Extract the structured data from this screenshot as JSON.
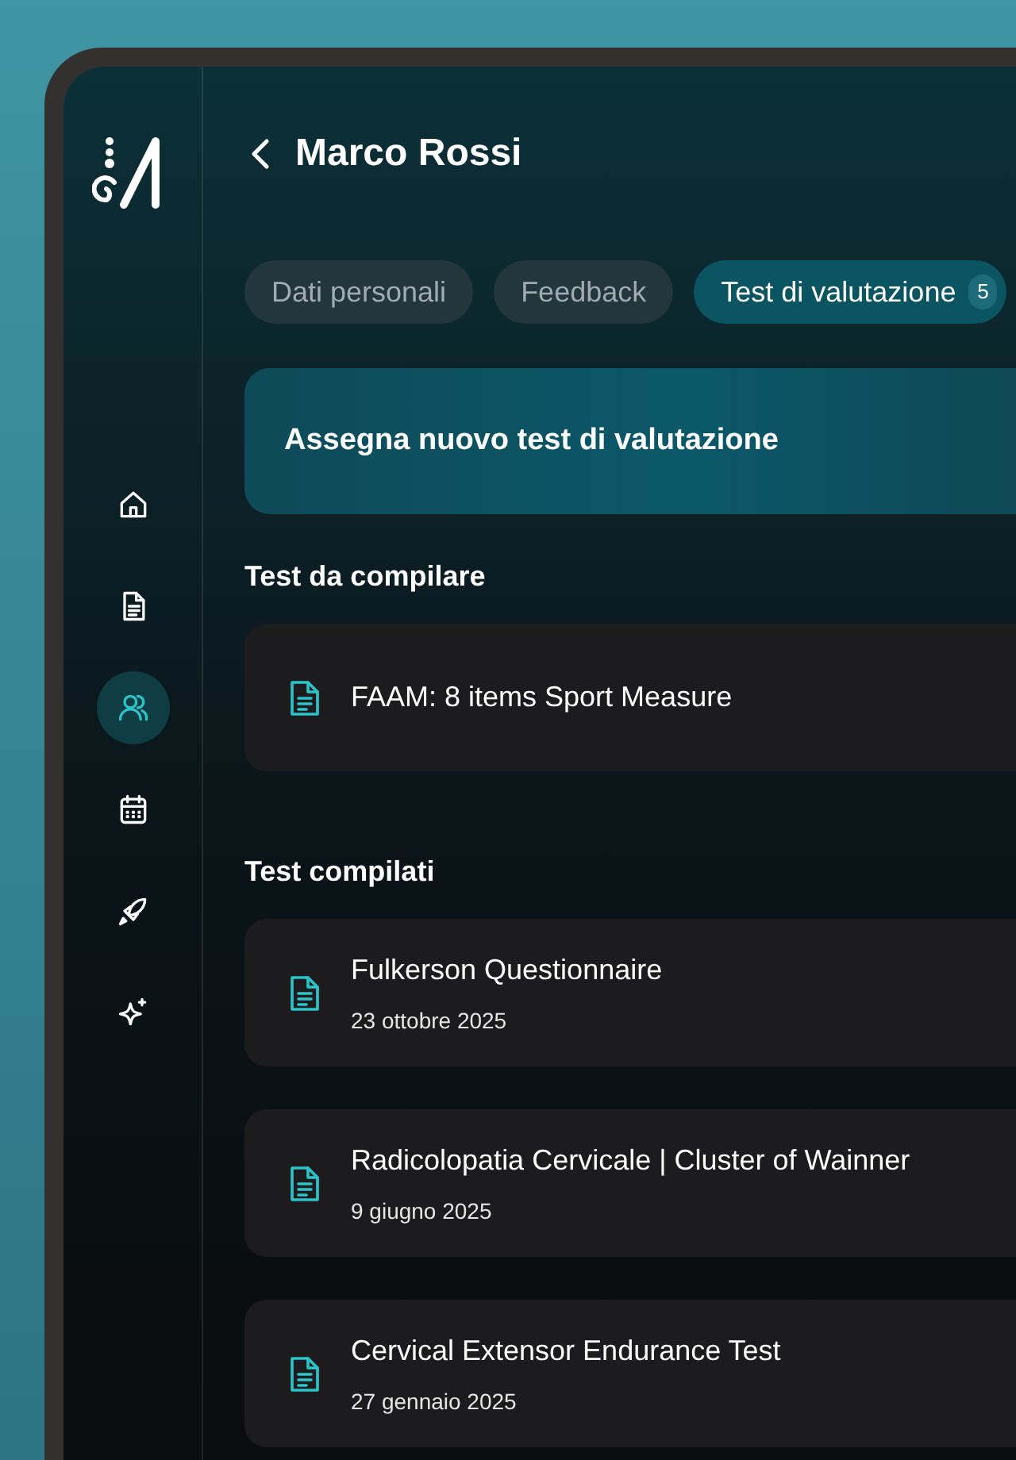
{
  "header": {
    "title": "Marco Rossi"
  },
  "sidebar": {
    "items": [
      {
        "kind": "home",
        "selected": false
      },
      {
        "kind": "document",
        "selected": false
      },
      {
        "kind": "users",
        "selected": true
      },
      {
        "kind": "calendar",
        "selected": false
      },
      {
        "kind": "rocket",
        "selected": false
      },
      {
        "kind": "sparkle",
        "selected": false
      }
    ]
  },
  "tabs": [
    {
      "label": "Dati personali",
      "selected": false
    },
    {
      "label": "Feedback",
      "selected": false
    },
    {
      "label": "Test di valutazione",
      "selected": true,
      "badge": "5"
    }
  ],
  "banner": {
    "text": "Assegna nuovo test di valutazione"
  },
  "sections": [
    {
      "title": "Test da compilare",
      "items": [
        {
          "title": "FAAM: 8 items Sport Measure"
        }
      ]
    },
    {
      "title": "Test compilati",
      "items": [
        {
          "title": "Fulkerson Questionnaire",
          "date": "23 ottobre 2025"
        },
        {
          "title": "Radicolopatia Cervicale | Cluster of Wainner",
          "date": "9 giugno 2025"
        },
        {
          "title": "Cervical Extensor Endurance Test",
          "date": "27 gennaio 2025"
        }
      ]
    }
  ]
}
